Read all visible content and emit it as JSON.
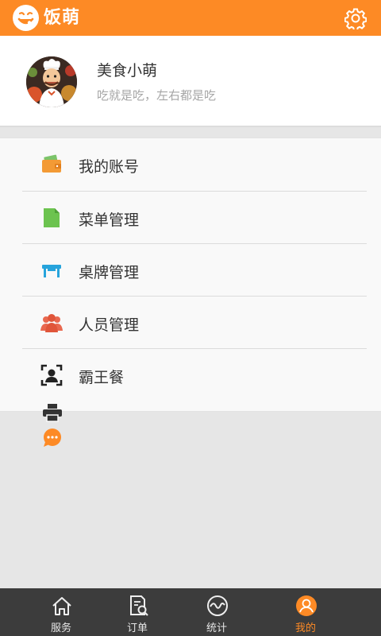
{
  "app": {
    "logo_text": "饭萌",
    "accent_color": "#fd8a25",
    "settings_icon": "gear-icon"
  },
  "profile": {
    "name": "美食小萌",
    "signature": "吃就是吃，左右都是吃",
    "avatar": "chef-avatar"
  },
  "menu": {
    "items": [
      {
        "label": "我的账号",
        "icon": "wallet-icon"
      },
      {
        "label": "菜单管理",
        "icon": "document-icon"
      },
      {
        "label": "桌牌管理",
        "icon": "table-icon"
      },
      {
        "label": "人员管理",
        "icon": "people-icon"
      },
      {
        "label": "霸王餐",
        "icon": "person-frame-icon"
      }
    ]
  },
  "extra_icons": [
    "printer-icon",
    "chat-bubble-icon"
  ],
  "tabbar": {
    "tabs": [
      {
        "label": "服务",
        "icon": "home-icon",
        "active": false
      },
      {
        "label": "订单",
        "icon": "order-search-icon",
        "active": false
      },
      {
        "label": "统计",
        "icon": "wave-icon",
        "active": false
      },
      {
        "label": "我的",
        "icon": "user-icon",
        "active": true
      }
    ]
  }
}
